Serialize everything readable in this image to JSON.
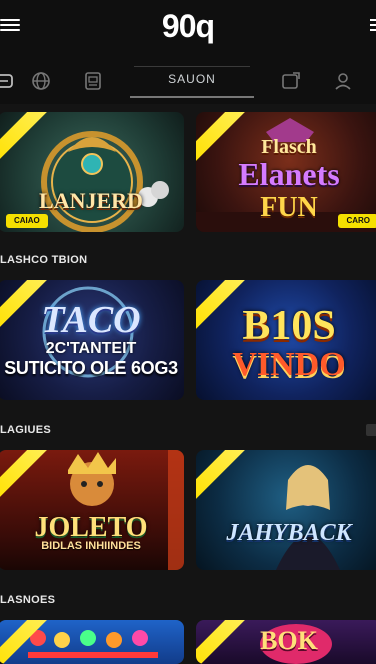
{
  "header": {
    "logo": "90q"
  },
  "categories": {
    "active_label": "SAUON"
  },
  "tiles": {
    "t1": {
      "title": "LANJERD",
      "badge": "CAIAO"
    },
    "t2": {
      "title_line1": "Flasch",
      "title_line2": "Elanets",
      "title_line3": "FUN",
      "badge": "CARO"
    },
    "t3": {
      "title_line1": "TACO",
      "title_line2": "2C'TANTEIT",
      "title_line3": "SUTICITO OLE 6OG3"
    },
    "t4": {
      "title_line1": "B10S",
      "title_line2": "VINDO"
    },
    "t5": {
      "title_line1": "JOLETO",
      "title_line2": "BIDLAS INHIINDES"
    },
    "t6": {
      "title": "JAHYBACK"
    },
    "t7": {
      "title": ""
    },
    "t8": {
      "title": "BOK"
    }
  },
  "sections": {
    "s1": "LASHCO TBION",
    "s2": "LAGIUES",
    "s3": "LASNOES"
  },
  "colors": {
    "background": "#141414",
    "ribbon": "#ffe100",
    "badge": "#f5e000"
  },
  "icons": [
    "hamburger-menu-icon",
    "card-icon",
    "globe-icon",
    "slot-icon",
    "transfer-icon",
    "person-icon",
    "menu-icon"
  ]
}
